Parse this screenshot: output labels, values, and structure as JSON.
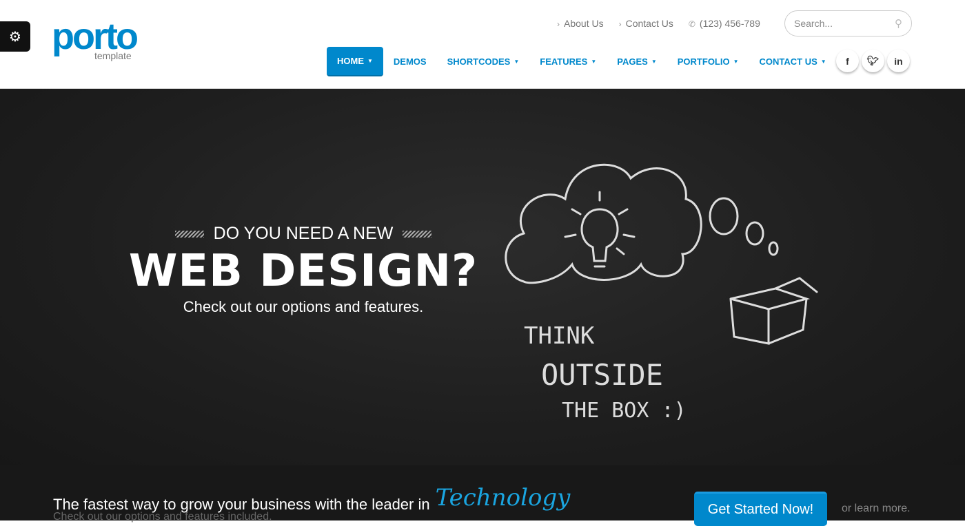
{
  "logo": {
    "word": "porto",
    "sub": "template"
  },
  "top_links": [
    {
      "label": "About Us"
    },
    {
      "label": "Contact Us"
    }
  ],
  "phone": "(123) 456-789",
  "search": {
    "placeholder": "Search..."
  },
  "nav": [
    {
      "label": "HOME",
      "caret": true,
      "active": true
    },
    {
      "label": "DEMOS"
    },
    {
      "label": "SHORTCODES",
      "caret": true
    },
    {
      "label": "FEATURES",
      "caret": true
    },
    {
      "label": "PAGES",
      "caret": true
    },
    {
      "label": "PORTFOLIO",
      "caret": true
    },
    {
      "label": "CONTACT US",
      "caret": true
    }
  ],
  "social": [
    "f",
    "t",
    "in"
  ],
  "hero": {
    "pre": "DO YOU NEED A NEW",
    "title": "WEB DESIGN?",
    "subtitle": "Check out our options and features.",
    "chalk": {
      "line1": "THINK",
      "line2": "OUTSIDE",
      "line3": "THE BOX :)"
    }
  },
  "cta": {
    "text": "The fastest way to grow your business with the leader in",
    "highlight": "Technology",
    "sub": "Check out our options and features included.",
    "button": "Get Started Now!",
    "learn": "or learn more."
  },
  "colors": {
    "brand": "#0088cc"
  }
}
